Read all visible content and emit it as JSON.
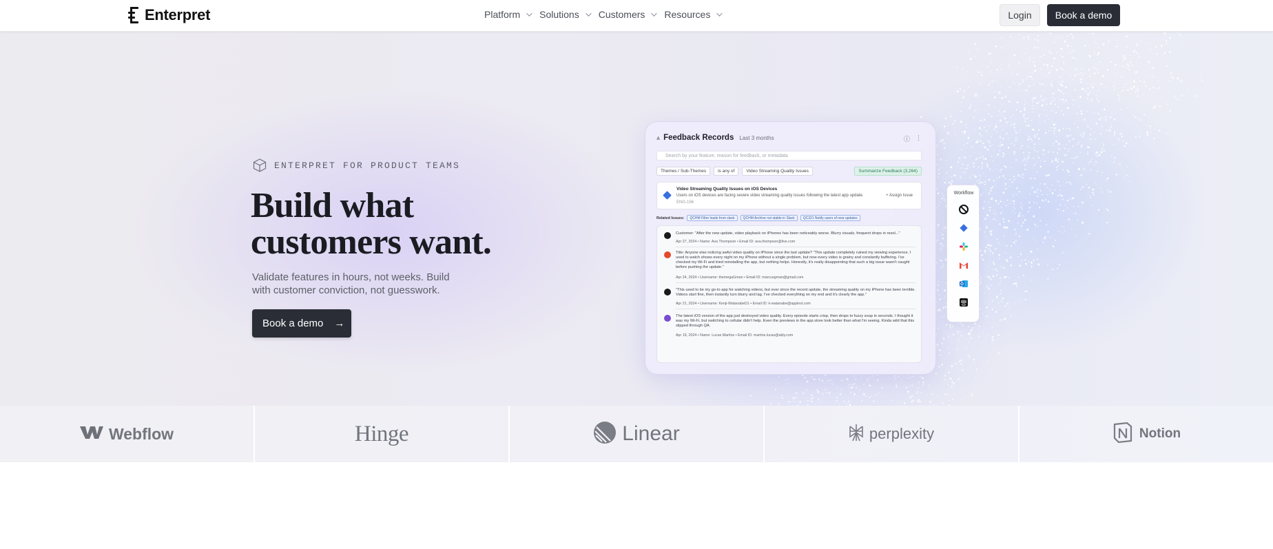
{
  "nav": {
    "brand": "Enterpret",
    "menu": [
      {
        "label": "Platform"
      },
      {
        "label": "Solutions"
      },
      {
        "label": "Customers"
      },
      {
        "label": "Resources"
      }
    ],
    "login_label": "Login",
    "demo_label": "Book a demo"
  },
  "hero": {
    "eyebrow": "ENTERPRET FOR PRODUCT TEAMS",
    "headline": "Build what customers want.",
    "subtext": "Validate features in hours, not weeks. Build with customer conviction, not guesswork.",
    "cta_label": "Book a demo"
  },
  "product_card": {
    "title": "Feedback Records",
    "range": "Last 3 months",
    "search_placeholder": "Search by your feature, reason for feedback, or metadata",
    "filters": [
      "Themes / Sub-Themes",
      "is any of",
      "Video Streaming Quality Issues"
    ],
    "summarize_label": "Summarize Feedback (3,264)",
    "issue": {
      "title": "Video Streaming Quality Issues on iOS Devices",
      "description": "Users on iOS devices are facing severe video streaming quality issues following the latest app update.",
      "code": "ENG-156",
      "action": "+ Assign Issue"
    },
    "related_label": "Related Issues:",
    "related": [
      "QCHM Filter loads from slack",
      "QCHM Archive not stable in Slack",
      "QC321 Notify users of new updates"
    ],
    "records": [
      {
        "text": "Customer: \"After the new update, video playback on iPhones has been noticeably worse. Blurry visuals, frequent drops in resol...\"",
        "meta": "Apr 27, 2024  •  Name: Ava Thompson  •  Email ID: ava.thompson@live.com",
        "color": "#1a1a1a"
      },
      {
        "text": "Title: Anyone else noticing awful video quality on iPhone since the last update? \"This update completely ruined my viewing experience. I used to watch shows every night on my iPhone without a single problem, but now every video is grainy and constantly buffering. I've checked my Wi-Fi and tried reinstalling the app, but nothing helps. Honestly, it's really disappointing that such a big issue wasn't caught before pushing the update.\"",
        "meta": "Apr 24, 2024  •  Username: themegaGman  •  Email ID: marcusgman@gmail.com",
        "color": "#e5482d"
      },
      {
        "text": "\"This used to be my go-to app for watching videos, but ever since the recent update, the streaming quality on my iPhone has been terrible. Videos start fine, then instantly turn blurry and lag. I've checked everything on my end and it's clearly the app.\"",
        "meta": "Apr 21, 2024  •  Username: Kenji-WatanabeD1  •  Email ID: k-watanabe@applest.com",
        "color": "#1a1a1a"
      },
      {
        "text": "The latest iOS version of the app just destroyed video quality. Every episode starts crisp, then drops to fuzzy soup in seconds. I thought it was my Wi-Fi, but switching to cellular didn't help. Even the previews in the app store look better than what I'm seeing. Kinda wild that this slipped through QA.",
        "meta": "Apr 19, 2024  •  Name: Lucas Martins  •  Email ID: martins.lucas@ably.com",
        "color": "#7b4bd1"
      }
    ]
  },
  "workflow": {
    "label": "Workflow",
    "icons": [
      "openai-icon",
      "linear-diamond-icon",
      "slack-icon",
      "gmail-icon",
      "outlook-icon",
      "intercom-icon"
    ]
  },
  "customer_logos": [
    {
      "name": "Webflow",
      "icon": "webflow-icon"
    },
    {
      "name": "Hinge",
      "icon": "hinge-wordmark"
    },
    {
      "name": "Linear",
      "icon": "linear-icon"
    },
    {
      "name": "perplexity",
      "icon": "perplexity-icon"
    },
    {
      "name": "Notion",
      "icon": "notion-icon"
    }
  ],
  "colors": {
    "primary_dark": "#2a2d36",
    "text": "#1a1c22",
    "muted": "#5d6068",
    "accent_blue": "#3a6fe0"
  }
}
